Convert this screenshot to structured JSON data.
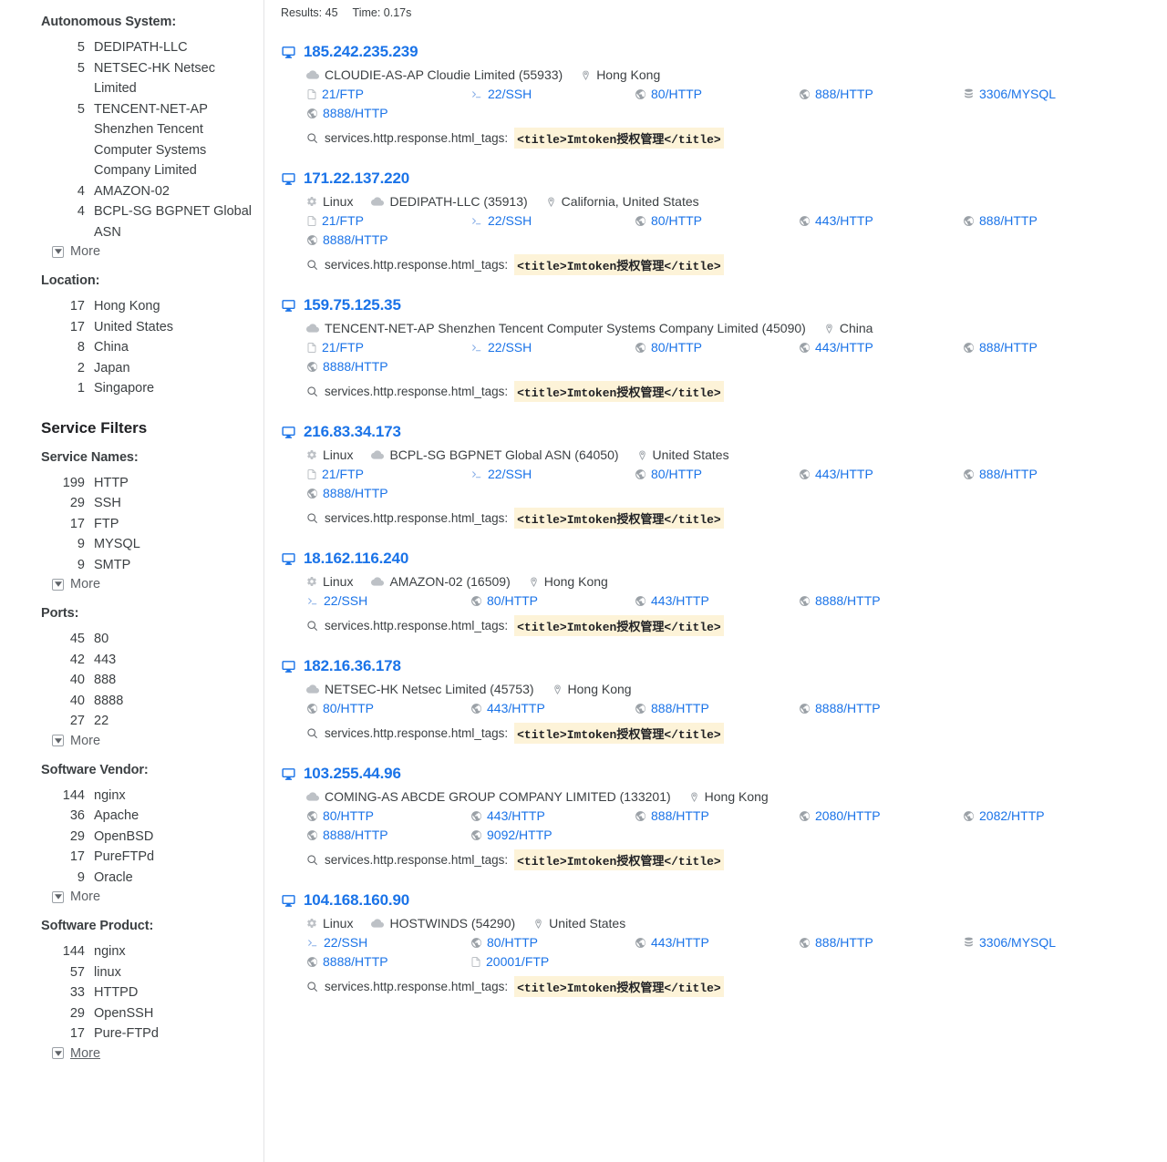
{
  "sidebar": {
    "facets": [
      {
        "title": "Autonomous System:",
        "type": "facet",
        "items": [
          {
            "count": "5",
            "label": "DEDIPATH-LLC"
          },
          {
            "count": "5",
            "label": "NETSEC-HK Netsec Limited"
          },
          {
            "count": "5",
            "label": "TENCENT-NET-AP Shenzhen Tencent Computer Systems Company Limited"
          },
          {
            "count": "4",
            "label": "AMAZON-02"
          },
          {
            "count": "4",
            "label": "BCPL-SG BGPNET Global ASN"
          }
        ],
        "more": "More",
        "more_underlined": false
      },
      {
        "title": "Location:",
        "type": "facet",
        "items": [
          {
            "count": "17",
            "label": "Hong Kong"
          },
          {
            "count": "17",
            "label": "United States"
          },
          {
            "count": "8",
            "label": "China"
          },
          {
            "count": "2",
            "label": "Japan"
          },
          {
            "count": "1",
            "label": "Singapore"
          }
        ],
        "more": null
      },
      {
        "title": "Service Filters",
        "type": "section"
      },
      {
        "title": "Service Names:",
        "type": "facet",
        "items": [
          {
            "count": "199",
            "label": "HTTP"
          },
          {
            "count": "29",
            "label": "SSH"
          },
          {
            "count": "17",
            "label": "FTP"
          },
          {
            "count": "9",
            "label": "MYSQL"
          },
          {
            "count": "9",
            "label": "SMTP"
          }
        ],
        "more": "More",
        "more_underlined": false
      },
      {
        "title": "Ports:",
        "type": "facet",
        "items": [
          {
            "count": "45",
            "label": "80"
          },
          {
            "count": "42",
            "label": "443"
          },
          {
            "count": "40",
            "label": "888"
          },
          {
            "count": "40",
            "label": "8888"
          },
          {
            "count": "27",
            "label": "22"
          }
        ],
        "more": "More",
        "more_underlined": false
      },
      {
        "title": "Software Vendor:",
        "type": "facet",
        "items": [
          {
            "count": "144",
            "label": "nginx"
          },
          {
            "count": "36",
            "label": "Apache"
          },
          {
            "count": "29",
            "label": "OpenBSD"
          },
          {
            "count": "17",
            "label": "PureFTPd"
          },
          {
            "count": "9",
            "label": "Oracle"
          }
        ],
        "more": "More",
        "more_underlined": false
      },
      {
        "title": "Software Product:",
        "type": "facet",
        "items": [
          {
            "count": "144",
            "label": "nginx"
          },
          {
            "count": "57",
            "label": "linux"
          },
          {
            "count": "33",
            "label": "HTTPD"
          },
          {
            "count": "29",
            "label": "OpenSSH"
          },
          {
            "count": "17",
            "label": "Pure-FTPd"
          }
        ],
        "more": "More",
        "more_underlined": true
      }
    ]
  },
  "main": {
    "results_label": "Results: 45",
    "time_label": "Time: 0.17s",
    "tag_key": "services.http.response.html_tags:",
    "tag_value": "<title>Imtoken授权管理</title>",
    "accent_color": "#1a73e8",
    "highlight_color": "#fdf3d8",
    "results": [
      {
        "ip": "185.242.235.239",
        "os": null,
        "asn": "CLOUDIE-AS-AP Cloudie Limited (55933)",
        "location": "Hong Kong",
        "ports": [
          {
            "label": "21/FTP",
            "icon": "file-icon"
          },
          {
            "label": "22/SSH",
            "icon": "terminal-icon"
          },
          {
            "label": "80/HTTP",
            "icon": "globe-icon"
          },
          {
            "label": "888/HTTP",
            "icon": "globe-icon"
          },
          {
            "label": "3306/MYSQL",
            "icon": "database-icon"
          },
          {
            "label": "8888/HTTP",
            "icon": "globe-icon"
          }
        ]
      },
      {
        "ip": "171.22.137.220",
        "os": "Linux",
        "asn": "DEDIPATH-LLC (35913)",
        "location": "California, United States",
        "ports": [
          {
            "label": "21/FTP",
            "icon": "file-icon"
          },
          {
            "label": "22/SSH",
            "icon": "terminal-icon"
          },
          {
            "label": "80/HTTP",
            "icon": "globe-icon"
          },
          {
            "label": "443/HTTP",
            "icon": "globe-icon"
          },
          {
            "label": "888/HTTP",
            "icon": "globe-icon"
          },
          {
            "label": "8888/HTTP",
            "icon": "globe-icon"
          }
        ]
      },
      {
        "ip": "159.75.125.35",
        "os": null,
        "asn": "TENCENT-NET-AP Shenzhen Tencent Computer Systems Company Limited (45090)",
        "location": "China",
        "ports": [
          {
            "label": "21/FTP",
            "icon": "file-icon"
          },
          {
            "label": "22/SSH",
            "icon": "terminal-icon"
          },
          {
            "label": "80/HTTP",
            "icon": "globe-icon"
          },
          {
            "label": "443/HTTP",
            "icon": "globe-icon"
          },
          {
            "label": "888/HTTP",
            "icon": "globe-icon"
          },
          {
            "label": "8888/HTTP",
            "icon": "globe-icon"
          }
        ]
      },
      {
        "ip": "216.83.34.173",
        "os": "Linux",
        "asn": "BCPL-SG BGPNET Global ASN (64050)",
        "location": "United States",
        "ports": [
          {
            "label": "21/FTP",
            "icon": "file-icon"
          },
          {
            "label": "22/SSH",
            "icon": "terminal-icon"
          },
          {
            "label": "80/HTTP",
            "icon": "globe-icon"
          },
          {
            "label": "443/HTTP",
            "icon": "globe-icon"
          },
          {
            "label": "888/HTTP",
            "icon": "globe-icon"
          },
          {
            "label": "8888/HTTP",
            "icon": "globe-icon"
          }
        ]
      },
      {
        "ip": "18.162.116.240",
        "os": "Linux",
        "asn": "AMAZON-02 (16509)",
        "location": "Hong Kong",
        "ports": [
          {
            "label": "22/SSH",
            "icon": "terminal-icon"
          },
          {
            "label": "80/HTTP",
            "icon": "globe-icon"
          },
          {
            "label": "443/HTTP",
            "icon": "globe-icon"
          },
          {
            "label": "8888/HTTP",
            "icon": "globe-icon"
          }
        ]
      },
      {
        "ip": "182.16.36.178",
        "os": null,
        "asn": "NETSEC-HK Netsec Limited (45753)",
        "location": "Hong Kong",
        "ports": [
          {
            "label": "80/HTTP",
            "icon": "globe-icon"
          },
          {
            "label": "443/HTTP",
            "icon": "globe-icon"
          },
          {
            "label": "888/HTTP",
            "icon": "globe-icon"
          },
          {
            "label": "8888/HTTP",
            "icon": "globe-icon"
          }
        ]
      },
      {
        "ip": "103.255.44.96",
        "os": null,
        "asn": "COMING-AS ABCDE GROUP COMPANY LIMITED (133201)",
        "location": "Hong Kong",
        "ports": [
          {
            "label": "80/HTTP",
            "icon": "globe-icon"
          },
          {
            "label": "443/HTTP",
            "icon": "globe-icon"
          },
          {
            "label": "888/HTTP",
            "icon": "globe-icon"
          },
          {
            "label": "2080/HTTP",
            "icon": "globe-icon"
          },
          {
            "label": "2082/HTTP",
            "icon": "globe-icon"
          },
          {
            "label": "8888/HTTP",
            "icon": "globe-icon"
          },
          {
            "label": "9092/HTTP",
            "icon": "globe-icon"
          }
        ]
      },
      {
        "ip": "104.168.160.90",
        "os": "Linux",
        "asn": "HOSTWINDS (54290)",
        "location": "United States",
        "ports": [
          {
            "label": "22/SSH",
            "icon": "terminal-icon"
          },
          {
            "label": "80/HTTP",
            "icon": "globe-icon"
          },
          {
            "label": "443/HTTP",
            "icon": "globe-icon"
          },
          {
            "label": "888/HTTP",
            "icon": "globe-icon"
          },
          {
            "label": "3306/MYSQL",
            "icon": "database-icon"
          },
          {
            "label": "8888/HTTP",
            "icon": "globe-icon"
          },
          {
            "label": "20001/FTP",
            "icon": "file-icon"
          }
        ]
      }
    ]
  }
}
